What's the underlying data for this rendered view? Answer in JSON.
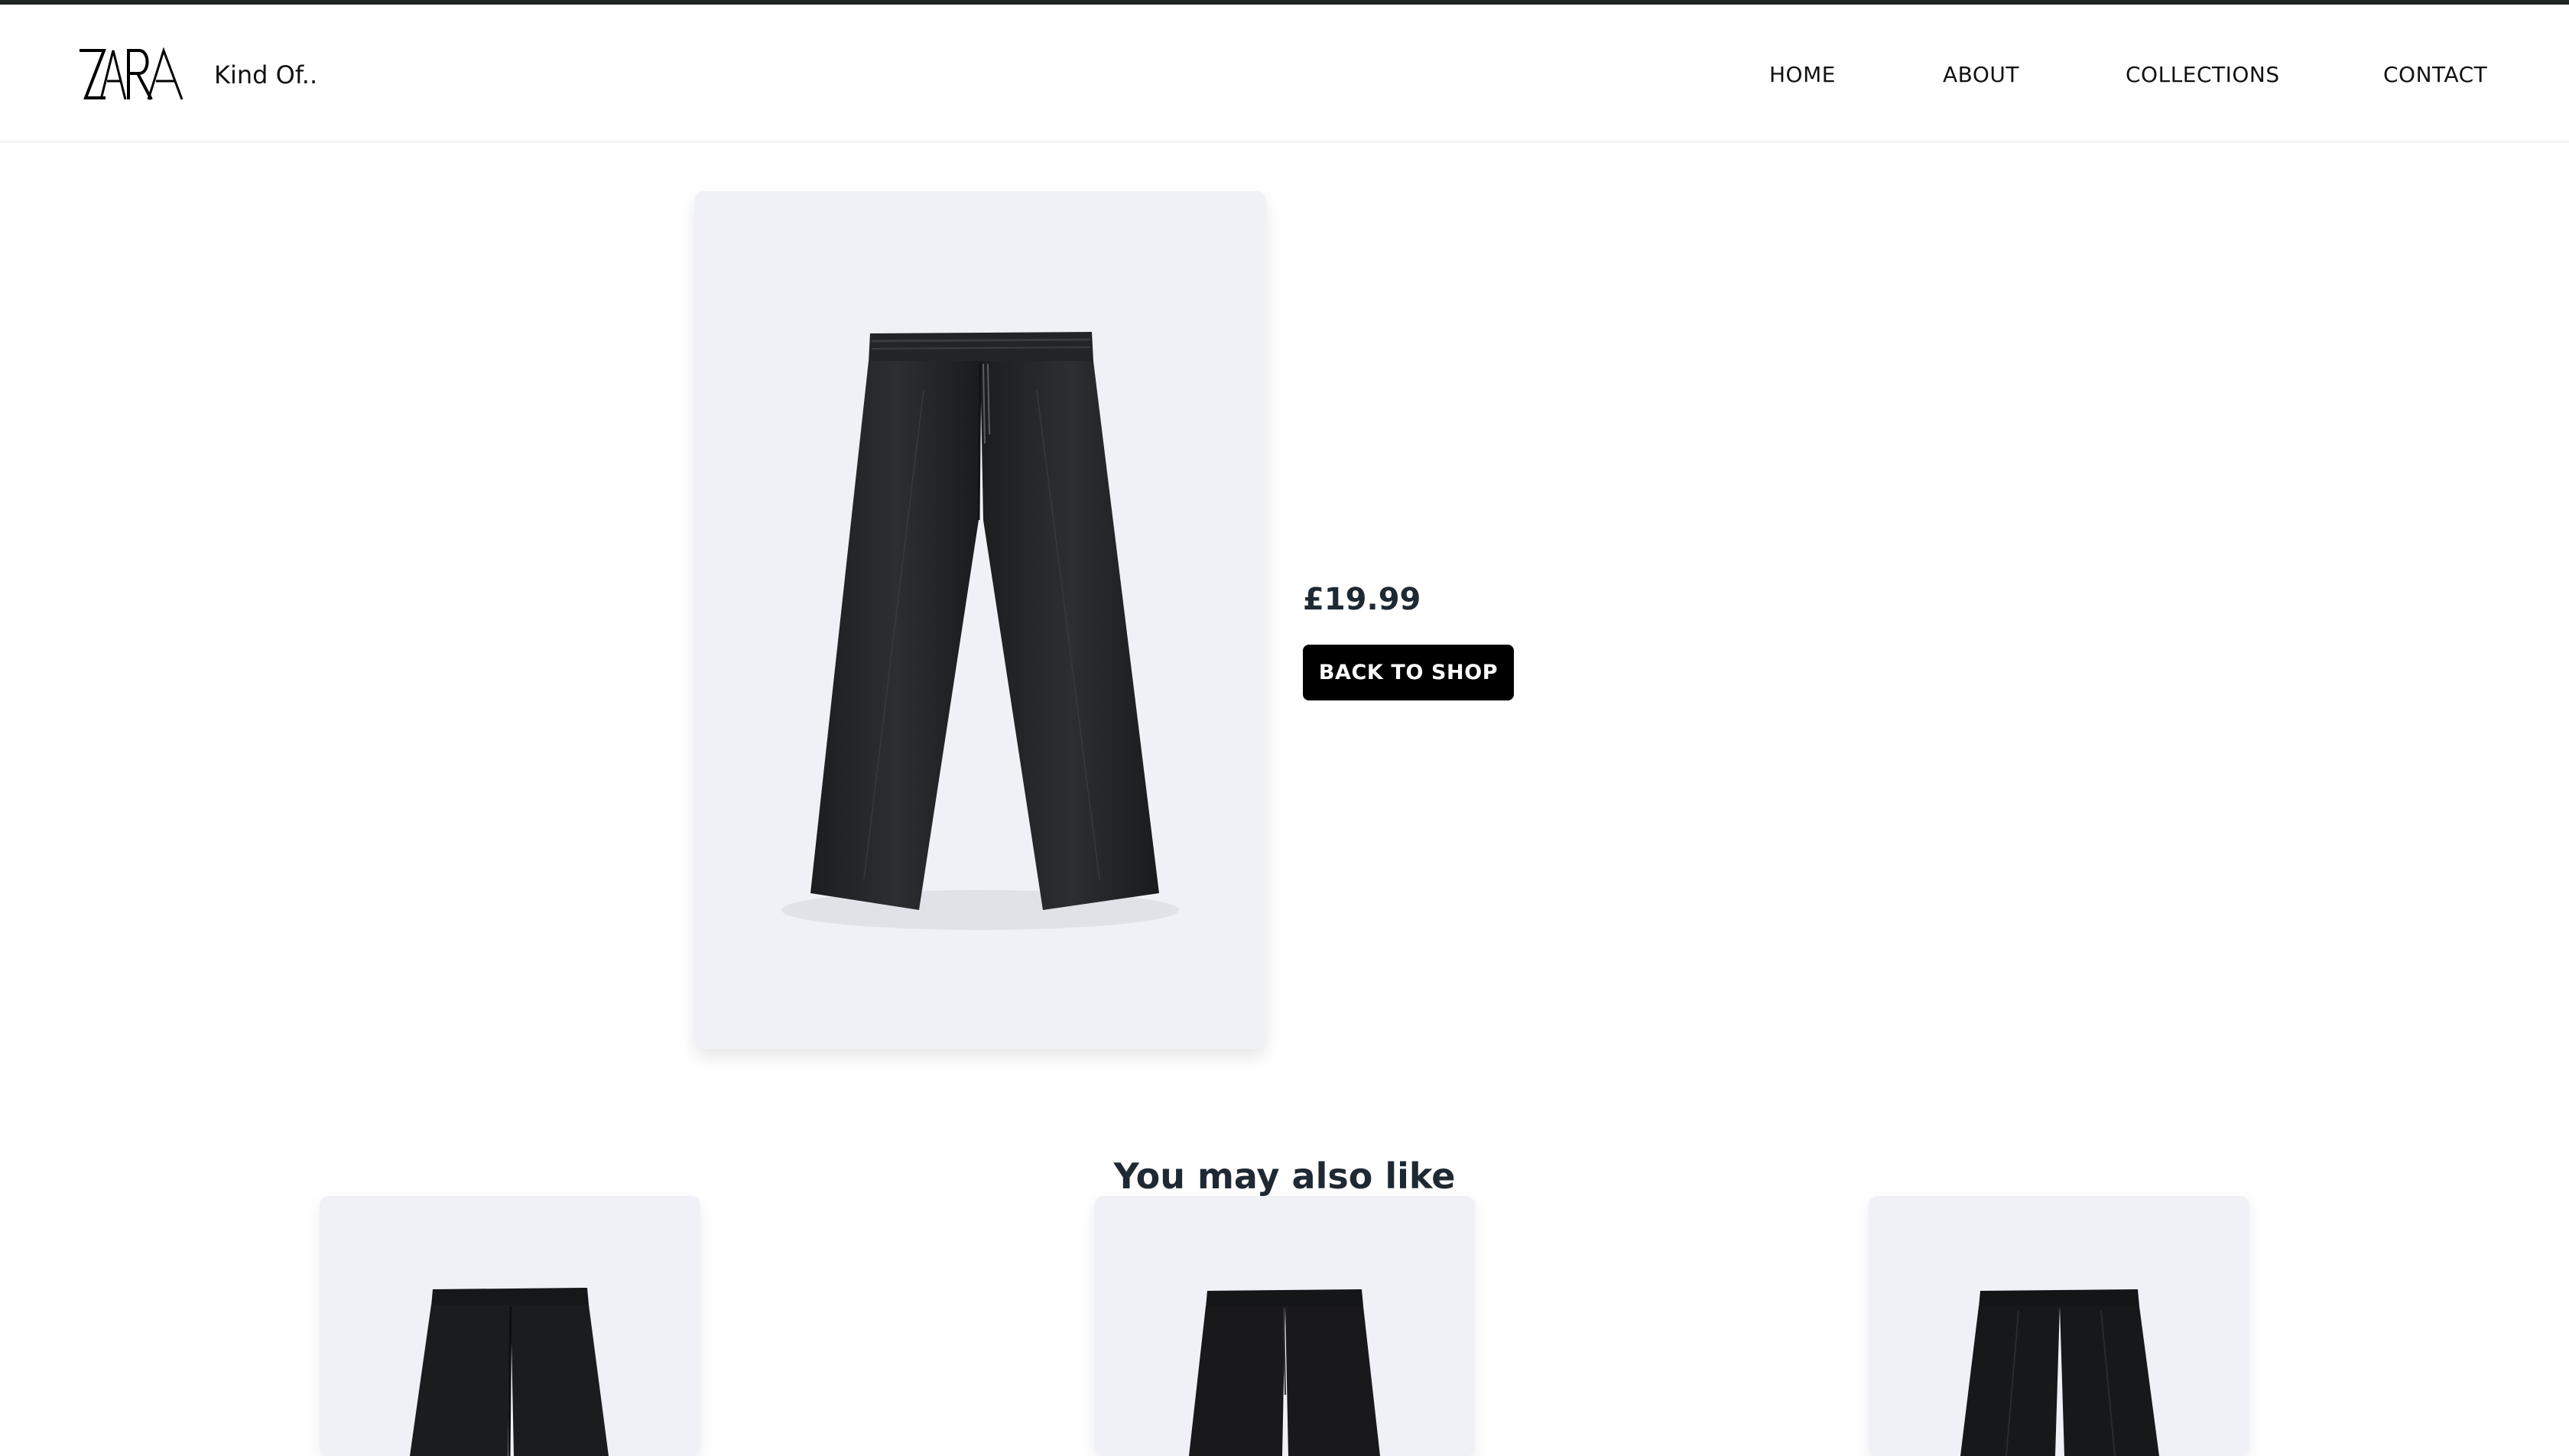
{
  "header": {
    "logo_text": "ZARA",
    "brand_tagline": "Kind Of..",
    "nav": [
      {
        "label": "HOME"
      },
      {
        "label": "ABOUT"
      },
      {
        "label": "COLLECTIONS"
      },
      {
        "label": "CONTACT"
      }
    ]
  },
  "product": {
    "image": "black-trousers-image",
    "price": "£19.99",
    "back_button_label": "BACK TO SHOP"
  },
  "related": {
    "heading": "You may also like",
    "items": [
      {
        "image": "black-trousers-image"
      },
      {
        "image": "black-trousers-image"
      },
      {
        "image": "black-trousers-image"
      }
    ]
  },
  "colors": {
    "accent_black": "#000000",
    "card_background": "#f0f1f6",
    "heading_text": "#1f2933",
    "top_rule": "#1f2523"
  }
}
